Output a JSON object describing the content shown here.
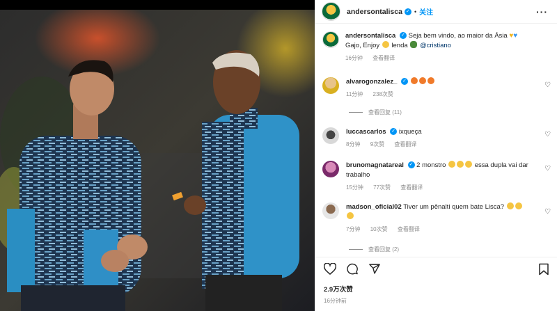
{
  "post": {
    "username": "andersontalisca",
    "follow_label": "关注",
    "separator": "•",
    "more_label": "···",
    "caption_text": "Seja bem vindo, ao maior da Ásia",
    "caption_text2": "Gajo, Enjoy",
    "caption_text3": "lenda",
    "caption_mention": "@cristiano",
    "caption_time": "16分钟",
    "caption_translate": "查看翻译",
    "likes": "2.9万次赞",
    "time": "16分钟前"
  },
  "comments": [
    {
      "username": "alvarogonzalez_",
      "verified": true,
      "text": "",
      "time": "11分钟",
      "likes": "238次赞",
      "translate": "",
      "replies": "查看回复 (11)"
    },
    {
      "username": "luccascarlos",
      "verified": true,
      "text": "ixqueça",
      "time": "8分钟",
      "likes": "9次赞",
      "translate": "查看翻译",
      "replies": ""
    },
    {
      "username": "brunomagnatareal",
      "verified": true,
      "text": "2 monstro",
      "text2": "essa dupla vai dar trabalho",
      "time": "15分钟",
      "likes": "77次赞",
      "translate": "查看翻译",
      "replies": ""
    },
    {
      "username": "madson_oficial02",
      "verified": false,
      "text": "Tiver um pênalti quem bate Lisca?",
      "time": "7分钟",
      "likes": "10次赞",
      "translate": "查看翻译",
      "replies": "查看回复 (2)"
    }
  ],
  "icons": [
    "like-icon",
    "comment-icon",
    "share-icon",
    "bookmark-icon",
    "heart-icon",
    "verified-icon"
  ],
  "colors": {
    "accent": "#0095f6",
    "muted": "#8e8e8e",
    "text": "#262626",
    "mention": "#00376b"
  }
}
